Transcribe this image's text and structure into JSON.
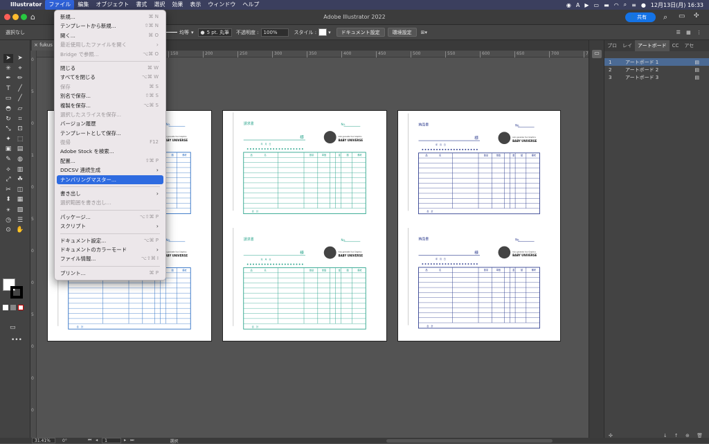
{
  "menubar": {
    "items": [
      "Illustrator",
      "ファイル",
      "編集",
      "オブジェクト",
      "書式",
      "選択",
      "効果",
      "表示",
      "ウィンドウ",
      "ヘルプ"
    ],
    "active_index": 1,
    "clock": "12月13日(月) 16:33"
  },
  "titlebar": {
    "title": "Adobe Illustrator 2022",
    "share_label": "共有"
  },
  "controlbar": {
    "selection": "選択なし",
    "stroke_profile": "均等",
    "brush": "5 pt. 丸筆",
    "opacity_label": "不透明度 :",
    "opacity_value": "100%",
    "style_label": "スタイル :",
    "doc_setup_button": "ドキュメント設定",
    "prefs_button": "環境設定"
  },
  "tab": {
    "name": "fukus",
    "close": "×"
  },
  "ruler": {
    "h_ticks": [
      "150",
      "200",
      "250",
      "300",
      "350",
      "400",
      "450",
      "500",
      "550",
      "600",
      "650",
      "700",
      "750",
      "800",
      "850"
    ],
    "v_ticks": [
      "0",
      "5",
      "0",
      "1",
      "0",
      "5",
      "0",
      "0",
      "5",
      "0",
      "0",
      "0"
    ]
  },
  "file_menu": {
    "items": [
      {
        "label": "新規...",
        "shortcut": "⌘ N",
        "disabled": false
      },
      {
        "label": "テンプレートから新規...",
        "shortcut": "⇧⌘ N",
        "disabled": false
      },
      {
        "label": "開く...",
        "shortcut": "⌘ O",
        "disabled": false
      },
      {
        "label": "最近使用したファイルを開く",
        "shortcut": "",
        "submenu": true,
        "disabled": true
      },
      {
        "label": "Bridge で参照...",
        "shortcut": "⌥⌘ O",
        "disabled": true
      },
      {
        "sep": true
      },
      {
        "label": "閉じる",
        "shortcut": "⌘ W",
        "disabled": false
      },
      {
        "label": "すべてを閉じる",
        "shortcut": "⌥⌘ W",
        "disabled": false
      },
      {
        "label": "保存",
        "shortcut": "⌘ S",
        "disabled": true
      },
      {
        "label": "別名で保存...",
        "shortcut": "⇧⌘ S",
        "disabled": false
      },
      {
        "label": "複製を保存...",
        "shortcut": "⌥⌘ S",
        "disabled": false
      },
      {
        "label": "選択したスライスを保存...",
        "shortcut": "",
        "disabled": true
      },
      {
        "label": "バージョン履歴",
        "shortcut": "",
        "disabled": false
      },
      {
        "label": "テンプレートとして保存...",
        "shortcut": "",
        "disabled": false
      },
      {
        "label": "復帰",
        "shortcut": "F12",
        "disabled": true
      },
      {
        "label": "Adobe Stock を検索...",
        "shortcut": "",
        "disabled": false
      },
      {
        "label": "配置...",
        "shortcut": "⇧⌘ P",
        "disabled": false
      },
      {
        "label": "DDCSV 連続生成",
        "shortcut": "",
        "submenu": true,
        "disabled": false
      },
      {
        "label": "ナンバリングマスター...",
        "shortcut": "",
        "disabled": false,
        "highlight": true
      },
      {
        "sep": true
      },
      {
        "label": "書き出し",
        "shortcut": "",
        "submenu": true,
        "disabled": false
      },
      {
        "label": "選択範囲を書き出し...",
        "shortcut": "",
        "disabled": true
      },
      {
        "sep": true
      },
      {
        "label": "パッケージ...",
        "shortcut": "⌥⇧⌘ P",
        "disabled": false
      },
      {
        "label": "スクリプト",
        "shortcut": "",
        "submenu": true,
        "disabled": false
      },
      {
        "sep": true
      },
      {
        "label": "ドキュメント設定...",
        "shortcut": "⌥⌘ P",
        "disabled": false
      },
      {
        "label": "ドキュメントのカラーモード",
        "shortcut": "",
        "submenu": true,
        "disabled": false
      },
      {
        "label": "ファイル情報...",
        "shortcut": "⌥⇧⌘ I",
        "disabled": false
      },
      {
        "sep": true
      },
      {
        "label": "プリント...",
        "shortcut": "⌘ P",
        "disabled": false
      }
    ]
  },
  "panel": {
    "tabs": [
      "プロ",
      "レイ",
      "アートボード",
      "CC",
      "アセ"
    ],
    "active_tab": 2,
    "artboards": [
      {
        "num": "1",
        "name": "アートボード 1"
      },
      {
        "num": "2",
        "name": "アートボード 2"
      },
      {
        "num": "3",
        "name": "アートボード 3"
      }
    ]
  },
  "forms": {
    "invoice_title": "請求書",
    "delivery_title": "納品書",
    "sama": "様",
    "no_label": "No.",
    "date_line": "年　月　日",
    "brand": "BABY UNIVERSE",
    "brand_sub": "Auto generate Your Graphics",
    "total_label": "合　計",
    "col_headers": [
      "品",
      "名",
      "数量",
      "単価",
      "金",
      "額",
      "備考"
    ],
    "invoice_color": "#2aa48c",
    "delivery_color": "#2e3d8f",
    "partial_color": "#2d6fc4"
  },
  "status": {
    "zoom": "31.41%",
    "rotation": "0°",
    "artboard": "1",
    "tool": "選択"
  }
}
